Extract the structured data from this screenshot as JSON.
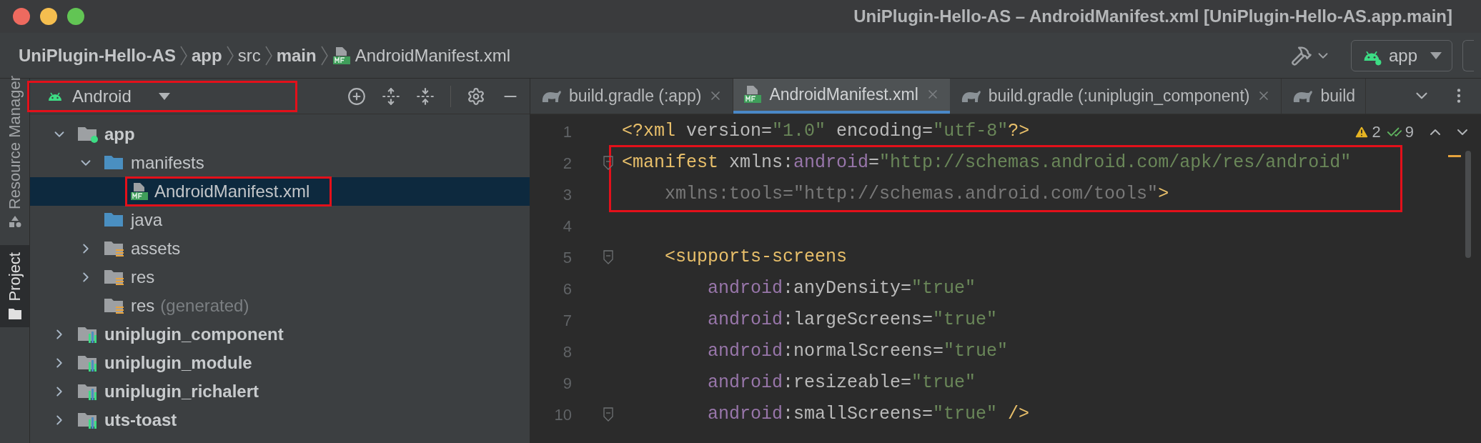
{
  "window": {
    "title": "UniPlugin-Hello-AS – AndroidManifest.xml [UniPlugin-Hello-AS.app.main]"
  },
  "breadcrumbs": [
    {
      "label": "UniPlugin-Hello-AS",
      "bold": true,
      "kind": "text"
    },
    {
      "label": "app",
      "bold": true,
      "kind": "text"
    },
    {
      "label": "src",
      "bold": false,
      "kind": "text"
    },
    {
      "label": "main",
      "bold": true,
      "kind": "text"
    },
    {
      "label": "AndroidManifest.xml",
      "bold": false,
      "kind": "manifest"
    }
  ],
  "toolbar": {
    "run_config": "app"
  },
  "side_strip": [
    {
      "label": "Resource Manager",
      "selected": false
    },
    {
      "label": "Project",
      "selected": true
    }
  ],
  "project_panel": {
    "view": "Android",
    "view_highlighted": true,
    "tree": [
      {
        "label": "app",
        "kind": "app",
        "bold": true,
        "expanded": true,
        "children": [
          {
            "label": "manifests",
            "kind": "folder",
            "expanded": true,
            "children": [
              {
                "label": "AndroidManifest.xml",
                "kind": "manifest",
                "selected": true,
                "highlighted": true
              }
            ]
          },
          {
            "label": "java",
            "kind": "folder",
            "selected": false
          },
          {
            "label": "assets",
            "kind": "res",
            "expanded": false
          },
          {
            "label": "res",
            "kind": "res",
            "expanded": false
          },
          {
            "label": "res",
            "kind": "res",
            "suffix": "(generated)",
            "selected": false
          }
        ]
      },
      {
        "label": "uniplugin_component",
        "kind": "module",
        "bold": true,
        "expanded": false
      },
      {
        "label": "uniplugin_module",
        "kind": "module",
        "bold": true,
        "expanded": false
      },
      {
        "label": "uniplugin_richalert",
        "kind": "module",
        "bold": true,
        "expanded": false
      },
      {
        "label": "uts-toast",
        "kind": "module",
        "bold": true,
        "expanded": false
      }
    ]
  },
  "tabs": [
    {
      "label": "build.gradle (:app)",
      "kind": "gradle",
      "selected": false,
      "closable": true
    },
    {
      "label": "AndroidManifest.xml",
      "kind": "manifest",
      "selected": true,
      "closable": true
    },
    {
      "label": "build.gradle (:uniplugin_component)",
      "kind": "gradle",
      "selected": false,
      "closable": true
    },
    {
      "label": "build",
      "kind": "gradle",
      "selected": false,
      "closable": false
    }
  ],
  "inspections": {
    "warnings": "2",
    "typos": "9"
  },
  "code": [
    {
      "number": "1",
      "fold": false,
      "boxed": false,
      "tokens": [
        {
          "text": "<?xml ",
          "kind": "tag"
        },
        {
          "text": "version",
          "kind": "attr"
        },
        {
          "text": "=",
          "kind": "attr"
        },
        {
          "text": "\"1.0\"",
          "kind": "str"
        },
        {
          "text": " encoding",
          "kind": "attr"
        },
        {
          "text": "=",
          "kind": "attr"
        },
        {
          "text": "\"utf-8\"",
          "kind": "str"
        },
        {
          "text": "?>",
          "kind": "tag"
        }
      ]
    },
    {
      "number": "2",
      "fold": true,
      "boxed": true,
      "tokens": [
        {
          "text": "<manifest ",
          "kind": "tag"
        },
        {
          "text": "xmlns:",
          "kind": "attr"
        },
        {
          "text": "android",
          "kind": "ns"
        },
        {
          "text": "=",
          "kind": "attr"
        },
        {
          "text": "\"http://schemas.android.com/apk/res/android\"",
          "kind": "str"
        }
      ]
    },
    {
      "number": "3",
      "fold": false,
      "boxed": true,
      "tokens": [
        {
          "text": "    xmlns:tools=\"http://schemas.android.com/tools\"",
          "kind": "unused"
        },
        {
          "text": ">",
          "kind": "tag"
        }
      ]
    },
    {
      "number": "4",
      "fold": false,
      "boxed": false
    },
    {
      "number": "5",
      "fold": true,
      "boxed": false,
      "tokens": [
        {
          "text": "    <supports-screens",
          "kind": "tag"
        }
      ]
    },
    {
      "number": "6",
      "fold": false,
      "boxed": false,
      "tokens": [
        {
          "text": "        android",
          "kind": "ns"
        },
        {
          "text": ":anyDensity=",
          "kind": "attr"
        },
        {
          "text": "\"true\"",
          "kind": "str"
        }
      ]
    },
    {
      "number": "7",
      "fold": false,
      "boxed": false,
      "tokens": [
        {
          "text": "        android",
          "kind": "ns"
        },
        {
          "text": ":largeScreens=",
          "kind": "attr"
        },
        {
          "text": "\"true\"",
          "kind": "str"
        }
      ]
    },
    {
      "number": "8",
      "fold": false,
      "boxed": false,
      "tokens": [
        {
          "text": "        android",
          "kind": "ns"
        },
        {
          "text": ":normalScreens=",
          "kind": "attr"
        },
        {
          "text": "\"true\"",
          "kind": "str"
        }
      ]
    },
    {
      "number": "9",
      "fold": false,
      "boxed": false,
      "tokens": [
        {
          "text": "        android",
          "kind": "ns"
        },
        {
          "text": ":resizeable=",
          "kind": "attr"
        },
        {
          "text": "\"true\"",
          "kind": "str"
        }
      ]
    },
    {
      "number": "10",
      "fold": true,
      "boxed": false,
      "tokens": [
        {
          "text": "        android",
          "kind": "ns"
        },
        {
          "text": ":smallScreens=",
          "kind": "attr"
        },
        {
          "text": "\"true\"",
          "kind": "str"
        },
        {
          "text": " />",
          "kind": "tag"
        }
      ]
    }
  ]
}
